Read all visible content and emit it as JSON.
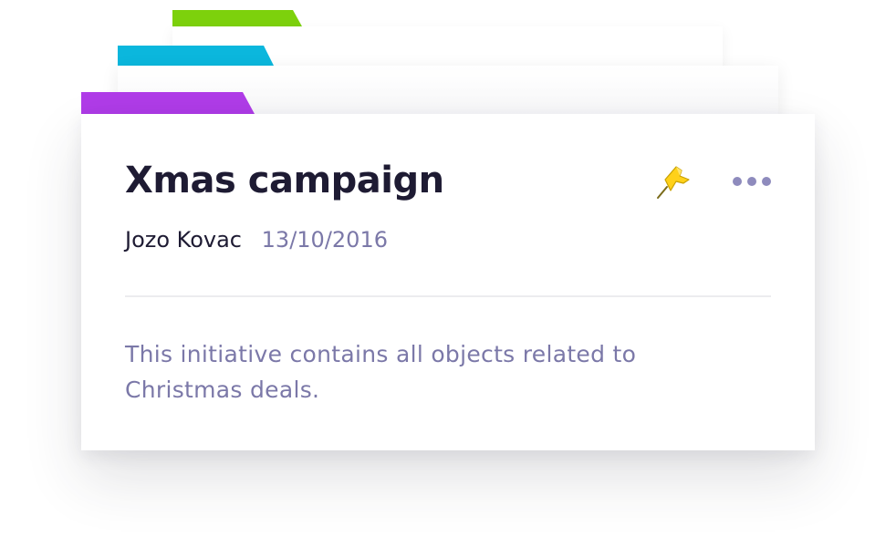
{
  "card": {
    "title": "Xmas campaign",
    "author": "Jozo Kovac",
    "date": "13/10/2016",
    "description": "This initiative contains all objects related to Christmas deals."
  },
  "actions": {
    "pin_icon": "pin-icon",
    "more_icon": "more-options-icon"
  },
  "colors": {
    "tab_green": "#7dd10c",
    "tab_blue": "#0bb7dd",
    "tab_purple": "#b03ce8",
    "title": "#1e1b33",
    "muted": "#7b78a8",
    "pin": "#ffd11a"
  }
}
